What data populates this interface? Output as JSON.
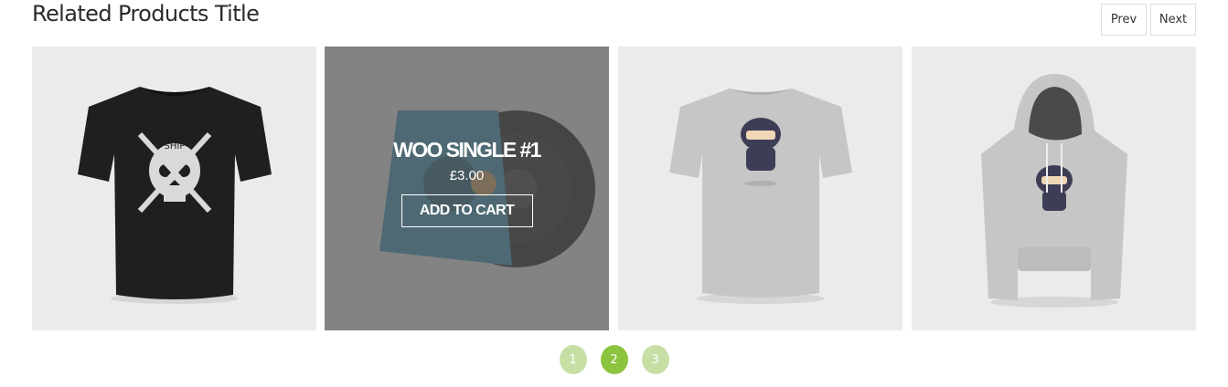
{
  "section": {
    "title": "Related Products Title"
  },
  "nav": {
    "prev_label": "Prev",
    "next_label": "Next"
  },
  "products": [
    {
      "name": "",
      "image_icon": "black-skull-tshirt-icon"
    },
    {
      "name": "WOO SINGLE #1",
      "price": "£3.00",
      "add_to_cart_label": "ADD TO CART",
      "image_icon": "vinyl-record-sleeve-icon",
      "hovered": true
    },
    {
      "name": "",
      "image_icon": "grey-ninja-tshirt-icon"
    },
    {
      "name": "",
      "image_icon": "grey-ninja-hoodie-icon"
    }
  ],
  "pagination": {
    "pages": [
      "1",
      "2",
      "3"
    ],
    "active_page": "2"
  },
  "colors": {
    "accent": "#8dc43f",
    "accent_light": "#c7dfa5",
    "card_background": "#ebebeb",
    "overlay": "#5a5a5a"
  }
}
